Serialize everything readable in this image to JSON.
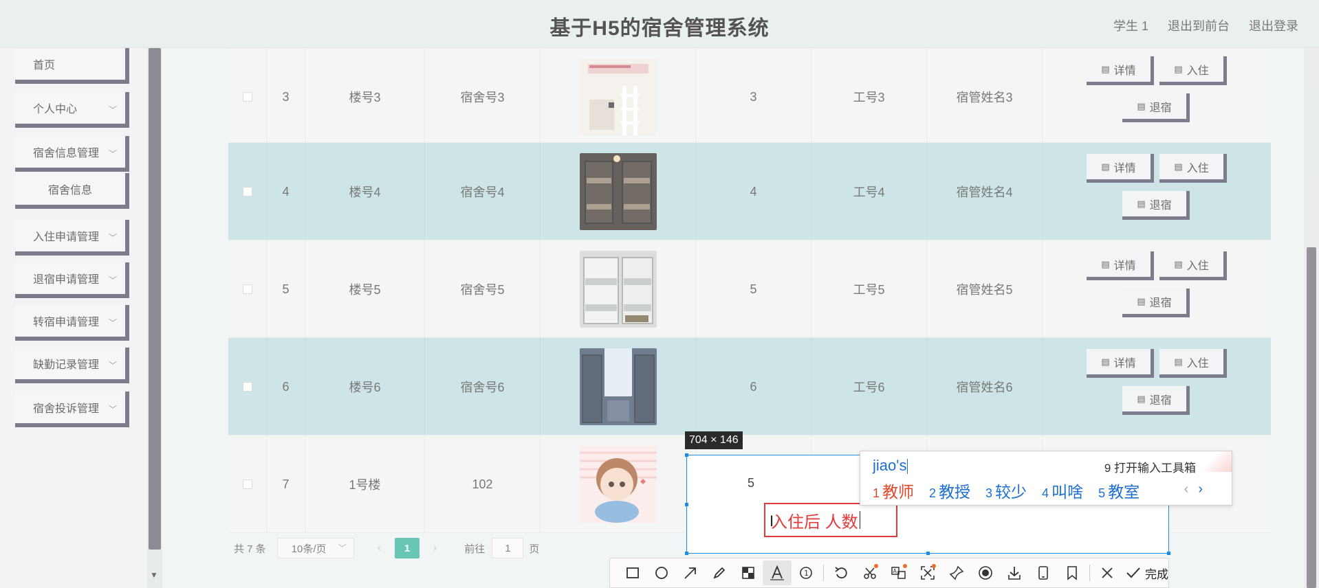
{
  "header": {
    "title": "基于H5的宿舍管理系统",
    "nav": [
      "学生 1",
      "退出到前台",
      "退出登录"
    ]
  },
  "sidebar": {
    "items": [
      {
        "label": "首页",
        "has_chevron": false
      },
      {
        "label": "个人中心",
        "has_chevron": true
      },
      {
        "label": "宿舍信息管理",
        "has_chevron": true
      },
      {
        "label": "宿舍信息",
        "has_chevron": false,
        "sub": true
      },
      {
        "label": "入住申请管理",
        "has_chevron": true
      },
      {
        "label": "退宿申请管理",
        "has_chevron": true
      },
      {
        "label": "转宿申请管理",
        "has_chevron": true
      },
      {
        "label": "缺勤记录管理",
        "has_chevron": true
      },
      {
        "label": "宿舍投诉管理",
        "has_chevron": true
      }
    ]
  },
  "table": {
    "rows": [
      {
        "index": "3",
        "building": "楼号3",
        "room": "宿舍号3",
        "beds": "3",
        "staff_id": "工号3",
        "staff_name": "宿管姓名3"
      },
      {
        "index": "4",
        "building": "楼号4",
        "room": "宿舍号4",
        "beds": "4",
        "staff_id": "工号4",
        "staff_name": "宿管姓名4"
      },
      {
        "index": "5",
        "building": "楼号5",
        "room": "宿舍号5",
        "beds": "5",
        "staff_id": "工号5",
        "staff_name": "宿管姓名5"
      },
      {
        "index": "6",
        "building": "楼号6",
        "room": "宿舍号6",
        "beds": "6",
        "staff_id": "工号6",
        "staff_name": "宿管姓名6"
      },
      {
        "index": "7",
        "building": "1号楼",
        "room": "102",
        "beds": "5",
        "staff_id": "",
        "staff_name": ""
      }
    ],
    "actions": {
      "detail": "详情",
      "checkin": "入住",
      "checkout": "退宿"
    }
  },
  "pagination": {
    "total": "共 7 条",
    "page_size": "10条/页",
    "current": "1",
    "goto_label": "前往",
    "goto_value": "1",
    "unit": "页"
  },
  "capture": {
    "size_label": "704 × 146",
    "text_input": "入住后 人数"
  },
  "ime": {
    "pinyin": "jiao's",
    "toolbox": "9 打开输入工具箱",
    "candidates": [
      {
        "num": "1",
        "text": "教师"
      },
      {
        "num": "2",
        "text": "教授"
      },
      {
        "num": "3",
        "text": "较少"
      },
      {
        "num": "4",
        "text": "叫啥"
      },
      {
        "num": "5",
        "text": "教室"
      }
    ]
  },
  "toolbar": {
    "tools": [
      "rectangle-icon",
      "ellipse-icon",
      "arrow-icon",
      "pen-icon",
      "mosaic-icon",
      "text-icon",
      "number-icon",
      "undo-icon",
      "cut-icon",
      "translate-icon",
      "ocr-icon",
      "pin-icon",
      "record-icon",
      "download-icon",
      "phone-icon",
      "bookmark-icon",
      "close-icon"
    ],
    "done_label": "完成"
  },
  "colors": {
    "accent": "#31b098",
    "row_alt": "#bcdcdf",
    "button_shadow": "#4a4a60",
    "ime_blue": "#1c6fd1",
    "ime_first": "#e2472b",
    "annotation_red": "#e23a3a",
    "selection_blue": "#1d8be8"
  }
}
